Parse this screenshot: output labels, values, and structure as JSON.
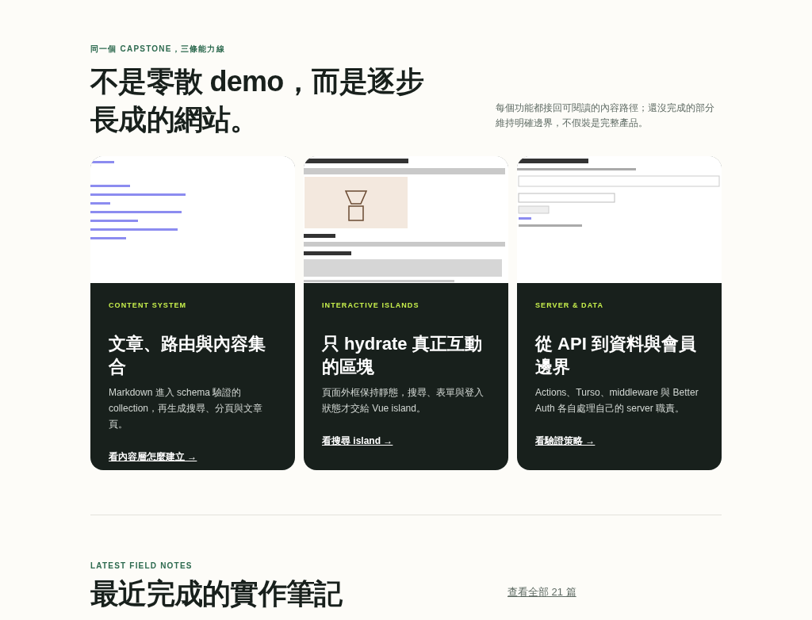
{
  "intro": {
    "eyebrow": "同一個 CAPSTONE，三條能力線",
    "title_lines": [
      "不是零散 demo，而是逐步",
      "長成的網站。"
    ],
    "note": "每個功能都接回可閱讀的內容路徑；還沒完成的部分維持明確邊界，不假裝是完整產品。"
  },
  "cards": [
    {
      "eyebrow": "CONTENT SYSTEM",
      "title": "文章、路由與內容集合",
      "description": "Markdown 進入 schema 驗證的 collection，再生成搜尋、分頁與文章頁。",
      "link": "看內容層怎麼建立 →"
    },
    {
      "eyebrow": "INTERACTIVE ISLANDS",
      "title": "只 hydrate 真正互動的區塊",
      "description": "頁面外框保持靜態，搜尋、表單與登入狀態才交給 Vue island。",
      "link": "看搜尋 island →"
    },
    {
      "eyebrow": "SERVER & DATA",
      "title": "從 API 到資料與會員邊界",
      "description": "Actions、Turso、middleware 與 Better Auth 各自處理自己的 server 職責。",
      "link": "看驗證策略 →"
    }
  ],
  "notes": {
    "eyebrow": "LATEST FIELD NOTES",
    "title": "最近完成的實作筆記",
    "link": "查看全部 21 篇"
  }
}
